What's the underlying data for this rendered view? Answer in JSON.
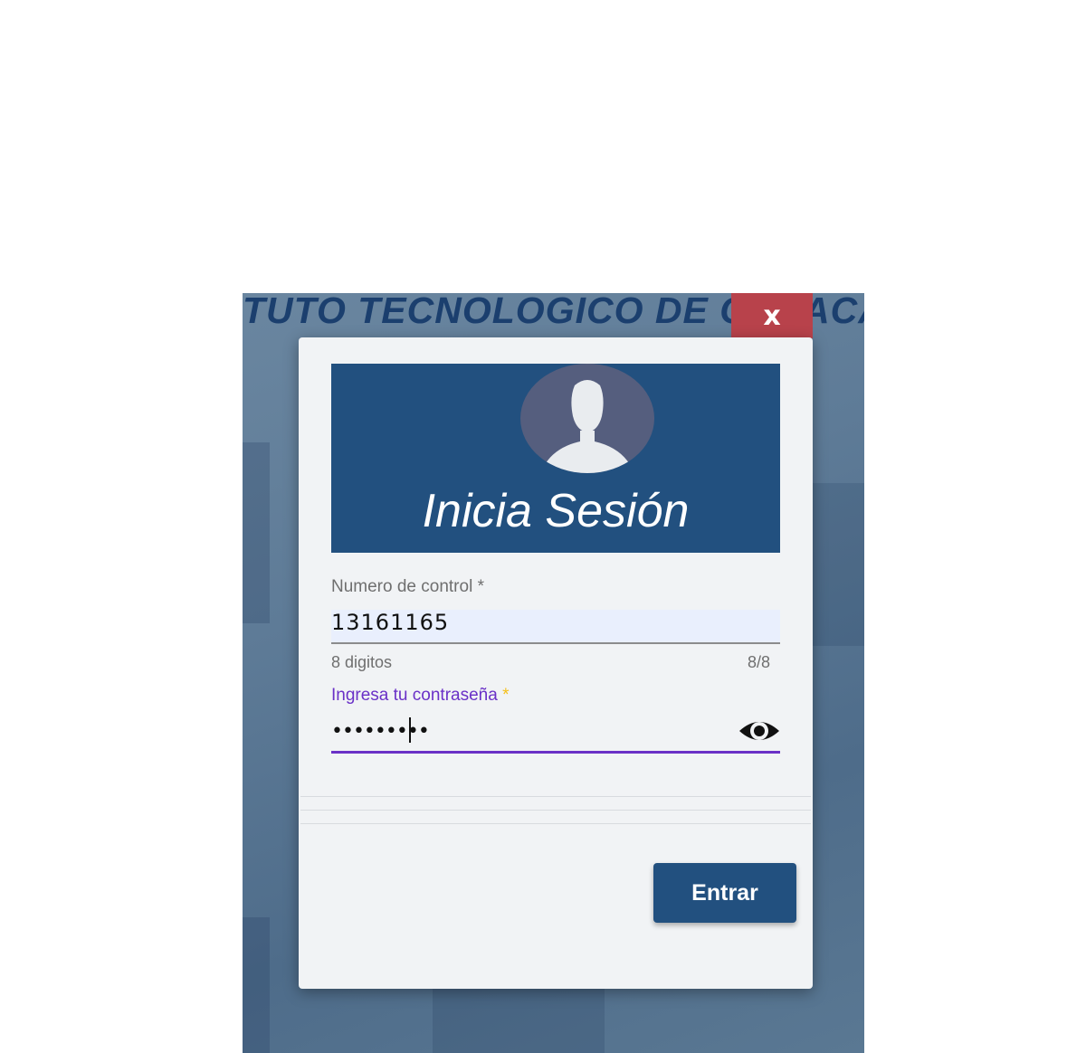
{
  "background": {
    "banner_text": "TUTO TECNOLOGICO DE OAXACA"
  },
  "dialog": {
    "close_label": "x",
    "title": "Inicia Sesión",
    "control_field": {
      "label": "Numero de control *",
      "value": "13161165",
      "hint": "8 digitos",
      "counter": "8/8"
    },
    "password_field": {
      "label": "Ingresa tu contraseña",
      "required_mark": "*",
      "masked_value": "•••••••••"
    },
    "icons": {
      "avatar": "user-avatar-icon",
      "visibility": "eye-icon"
    },
    "submit_label": "Entrar"
  },
  "colors": {
    "primary": "#22507f",
    "close": "#b8424b",
    "focus": "#6a31c7",
    "required": "#f4c01c"
  }
}
